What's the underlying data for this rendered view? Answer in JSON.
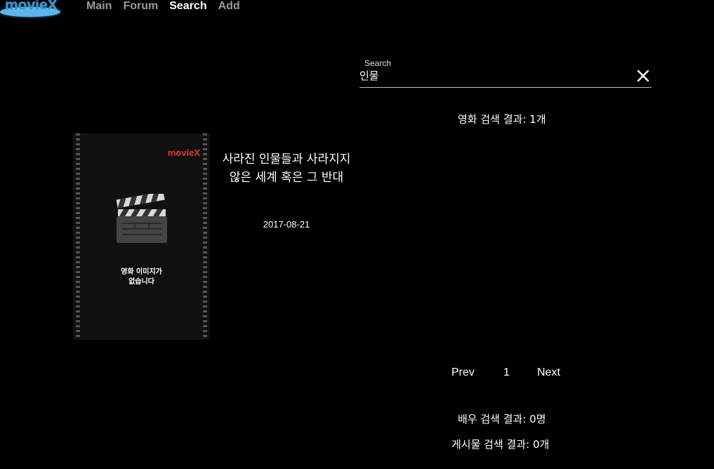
{
  "header": {
    "logo_text": "movieX",
    "nav": [
      {
        "label": "Main",
        "active": false
      },
      {
        "label": "Forum",
        "active": false
      },
      {
        "label": "Search",
        "active": true
      },
      {
        "label": "Add",
        "active": false
      }
    ]
  },
  "search": {
    "label": "Search",
    "value": "인물",
    "clear_icon": "close-icon"
  },
  "movies": {
    "count_text": "영화 검색 결과: 1개",
    "items": [
      {
        "poster_brand": "movieX",
        "poster_text": "영화 이미지가\n없습니다",
        "title": "사라진 인물들과 사라지지 않은 세계 혹은 그 반대",
        "date": "2017-08-21"
      }
    ]
  },
  "pagination": {
    "prev_label": "Prev",
    "page": "1",
    "next_label": "Next"
  },
  "actors": {
    "count_text": "배우 검색 결과: 0명"
  },
  "posts": {
    "count_text": "게시물 검색 결과: 0개"
  },
  "colors": {
    "background": "#000000",
    "logo_blue": "#2a93d5",
    "poster_brand_red": "#e03a2e",
    "nav_inactive": "#9a9a9a"
  }
}
